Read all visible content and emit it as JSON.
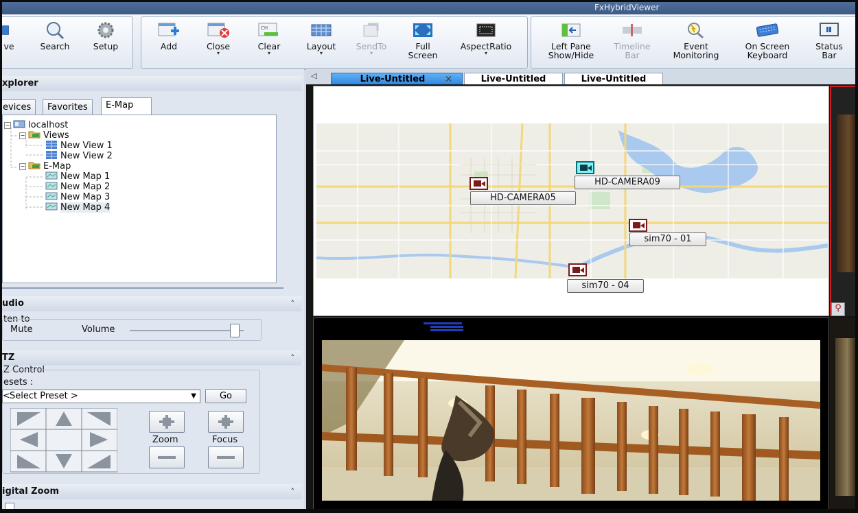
{
  "window": {
    "title": "FxHybridViewer"
  },
  "ribbon": {
    "buttons": [
      {
        "label": "ve",
        "icon": "save-icon"
      },
      {
        "label": "Search",
        "icon": "magnifier-icon"
      },
      {
        "label": "Setup",
        "icon": "gear-icon"
      },
      {
        "label": "Add",
        "icon": "add-window-icon"
      },
      {
        "label": "Close",
        "icon": "close-window-icon",
        "dropdown": "▾"
      },
      {
        "label": "Clear",
        "icon": "clear-channel-icon",
        "badge": "CH",
        "dropdown": "▾"
      },
      {
        "label": "Layout",
        "icon": "layout-grid-icon",
        "dropdown": "▾"
      },
      {
        "label": "SendTo",
        "icon": "send-to-icon",
        "dropdown": "▾",
        "disabled": true
      },
      {
        "label": "Full",
        "label2": "Screen",
        "icon": "full-screen-icon"
      },
      {
        "label": "AspectRatio",
        "icon": "aspect-ratio-icon",
        "dropdown": "▾"
      },
      {
        "label": "Left Pane",
        "label2": "Show/Hide",
        "icon": "left-pane-icon"
      },
      {
        "label": "Timeline",
        "label2": "Bar",
        "icon": "timeline-icon",
        "disabled": true
      },
      {
        "label": "Event",
        "label2": "Monitoring",
        "icon": "event-monitoring-icon"
      },
      {
        "label": "On Screen",
        "label2": "Keyboard",
        "icon": "keyboard-icon"
      },
      {
        "label": "Status",
        "label2": "Bar",
        "icon": "status-bar-icon"
      }
    ]
  },
  "explorer": {
    "header": "xplorer",
    "tabs": [
      "evices",
      "Favorites",
      "E-Map"
    ],
    "active_tab": "E-Map",
    "tree": {
      "root": "localhost",
      "views_label": "Views",
      "views": [
        "New View 1",
        "New View 2"
      ],
      "emap_label": "E-Map",
      "maps": [
        "New Map 1",
        "New Map 2",
        "New Map 3",
        "New Map 4"
      ]
    }
  },
  "audio": {
    "header": "udio",
    "listen_label": "ten to",
    "mute_label": "Mute",
    "volume_label": "Volume",
    "volume_level": 0.95
  },
  "ptz": {
    "header": "TZ",
    "control_label": "Z Control",
    "presets_label": "esets :",
    "preset_value": "Select Preset >",
    "go_label": "Go",
    "zoom_label": "Zoom",
    "focus_label": "Focus"
  },
  "digital_zoom": {
    "header": "igital Zoom"
  },
  "doc_tabs": [
    "Live-Untitled",
    "Live-Untitled",
    "Live-Untitled"
  ],
  "emap": {
    "cameras": [
      {
        "label": "HD-CAMERA09",
        "active": true
      },
      {
        "label": "HD-CAMERA05",
        "active": false
      },
      {
        "label": "sim70 - 01",
        "active": false
      },
      {
        "label": "sim70 - 04",
        "active": false
      }
    ]
  },
  "colors": {
    "accent_red": "#d21e1e",
    "camera_active": "#7ef3f9",
    "camera_marker": "#7a1a1a"
  }
}
